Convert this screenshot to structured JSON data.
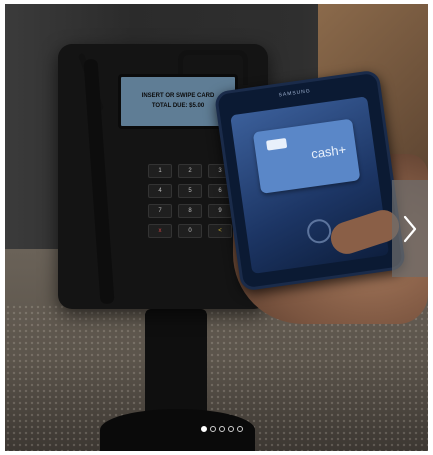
{
  "carousel": {
    "terminal_screen": {
      "line1": "INSERT OR SWIPE CARD",
      "line2": "TOTAL DUE: $5.00"
    },
    "phone": {
      "brand": "SAMSUNG",
      "card_label": "cash+"
    },
    "next_button": {
      "icon": "chevron-right-icon"
    },
    "pagination": {
      "slide_count": 5,
      "active_index": 0
    }
  },
  "keypad": [
    "1",
    "2",
    "3",
    "4",
    "5",
    "6",
    "7",
    "8",
    "9",
    "x",
    "0",
    "<"
  ]
}
